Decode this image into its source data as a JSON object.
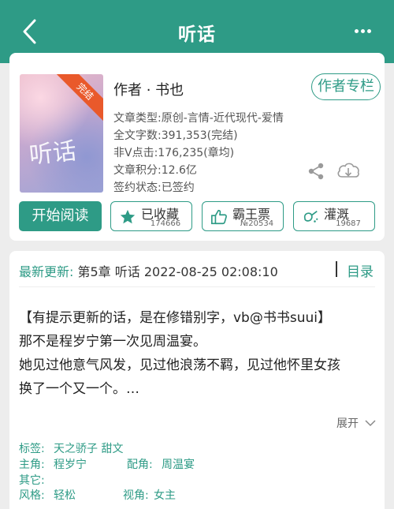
{
  "header": {
    "title": "听话"
  },
  "book": {
    "cover_title": "听话",
    "ribbon": "完结",
    "author_line": "作者 · 书也",
    "author_column_button": "作者专栏",
    "meta": [
      "文章类型:原创-言情-近代现代-爱情",
      "全文字数:391,353(完结)",
      "非Ⅴ点击:176,235(章均)",
      "文章积分:12.6亿",
      "签约状态:已签约"
    ]
  },
  "actions": {
    "read_button": "开始阅读",
    "collect": {
      "label": "已收藏",
      "count": "174666"
    },
    "tickets": {
      "label": "霸王票",
      "count": "№20534"
    },
    "irrigate": {
      "label": "灌溉",
      "count": "19687"
    }
  },
  "update": {
    "lead": "最新更新:",
    "chapter": "第5章 听话 2022-08-25 02:08:10",
    "directory_link": "目录"
  },
  "intro": {
    "lines": [
      "【有提示更新的话，是在修错别字，vb@书书suui】",
      "那不是程岁宁第一次见周温宴。",
      "她见过他意气风发，见过他浪荡不羁，见过他怀里女孩",
      "换了一个又一个。…"
    ],
    "expand": "展开"
  },
  "tags": {
    "tags_label": "标签:",
    "tags_value": "天之骄子   甜文",
    "lead_label": "主角:",
    "lead_value": "程岁宁",
    "support_label": "配角:",
    "support_value": "周温宴",
    "other_label": "其它:",
    "style_label": "风格:",
    "style_value": "轻松",
    "pov_label": "视角:",
    "pov_value": "女主"
  },
  "colors": {
    "accent": "#2e9b86",
    "ribbon": "#e9592b",
    "background": "#ededed"
  }
}
